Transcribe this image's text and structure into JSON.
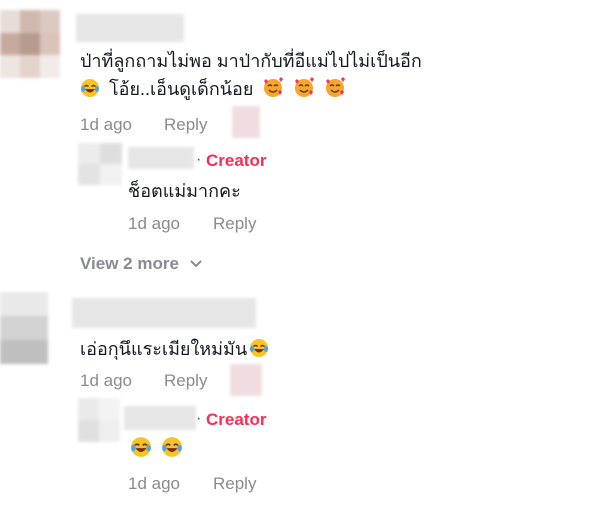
{
  "comments": [
    {
      "text_line1": "ป่าที่ลูกถามไม่พอ มาป่ากับที่อีแม่ไปไม่เป็นอีก",
      "text_line2": " โอ้ย..เอ็นดูเด็กน้อย",
      "time": "1d ago",
      "reply_label": "Reply",
      "reply": {
        "creator_badge": "Creator",
        "text": "ช็อตแม่มากคะ",
        "time": "1d ago",
        "reply_label": "Reply"
      },
      "view_more_label": "View 2 more"
    },
    {
      "text_line1": "เอ่อกุนึแระเมียใหม่มัน",
      "time": "1d ago",
      "reply_label": "Reply",
      "reply": {
        "creator_badge": "Creator",
        "time": "1d ago",
        "reply_label": "Reply"
      }
    }
  ],
  "icons": {
    "laugh": "laughing-crying-emoji-icon",
    "heart_face": "smiling-face-with-hearts-emoji-icon",
    "chevron": "chevron-down-icon"
  },
  "colors": {
    "creator": "#fe2c55",
    "meta": "#8a8b91",
    "text": "#161823"
  }
}
